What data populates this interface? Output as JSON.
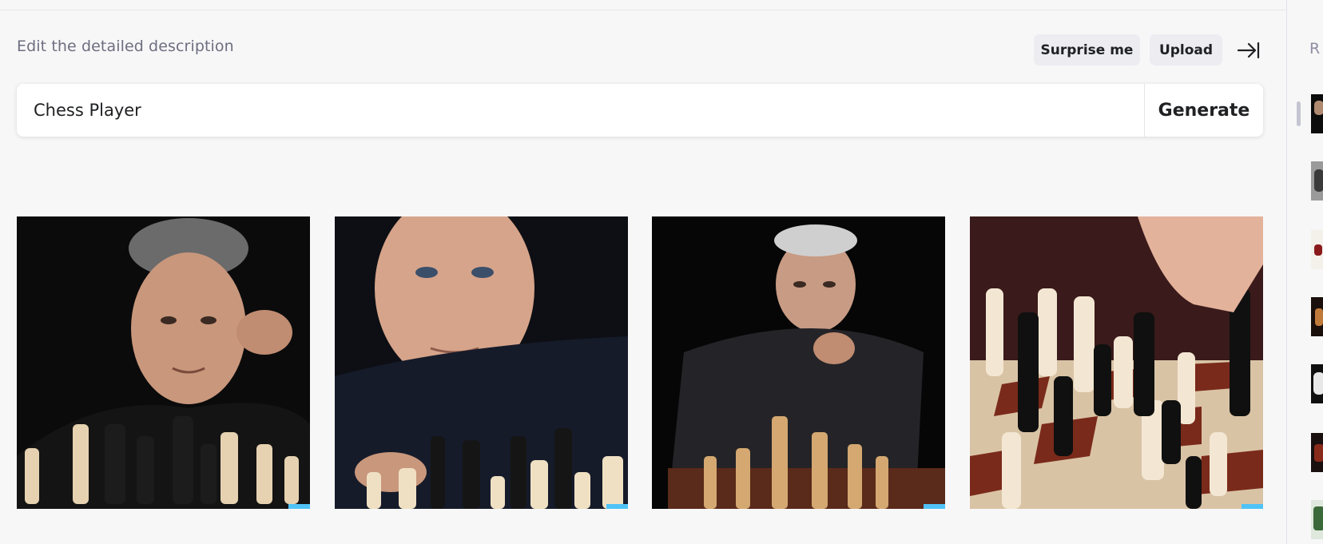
{
  "prompt": {
    "label": "Edit the detailed description",
    "value": "Chess Player",
    "generate_label": "Generate"
  },
  "toolbar": {
    "surprise_label": "Surprise me",
    "upload_label": "Upload",
    "collapse_icon": "collapse-panel-icon"
  },
  "results": [
    {
      "name": "result-image-1",
      "subject": "man with hand on cheek behind chess pieces"
    },
    {
      "name": "result-image-2",
      "subject": "man in dark shirt staring over chess pieces"
    },
    {
      "name": "result-image-3",
      "subject": "older man in black shirt with hand on chin at chess board"
    },
    {
      "name": "result-image-4",
      "subject": "hand moving piece on chess board close-up"
    }
  ],
  "sidebar": {
    "title": "R",
    "thumbnail_count": 8
  },
  "colors": {
    "background": "#f7f7f8",
    "button_bg": "#ececf1",
    "text": "#202123",
    "muted_text": "#6e6e80"
  }
}
